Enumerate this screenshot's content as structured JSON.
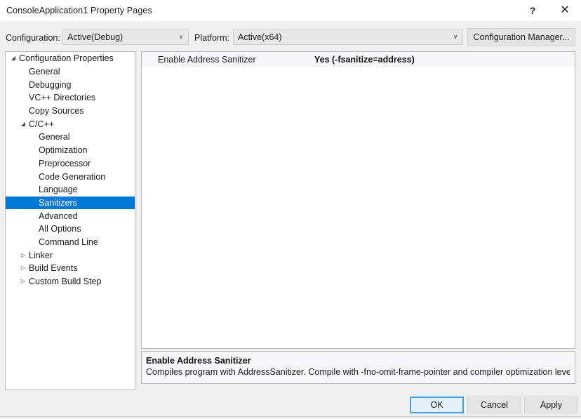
{
  "window": {
    "title": "ConsoleApplication1 Property Pages",
    "help_glyph": "?",
    "close_glyph": "✕"
  },
  "config_bar": {
    "configuration_label": "Configuration:",
    "configuration_value": "Active(Debug)",
    "platform_label": "Platform:",
    "platform_value": "Active(x64)",
    "configuration_manager_label": "Configuration Manager...",
    "dropdown_arrow": "∨"
  },
  "tree": {
    "arrow_expanded": "◢",
    "arrow_collapsed": "▷",
    "nodes": [
      {
        "label": "Configuration Properties",
        "indent": 0,
        "state": "expanded",
        "selected": false
      },
      {
        "label": "General",
        "indent": 1,
        "state": "leaf",
        "selected": false
      },
      {
        "label": "Debugging",
        "indent": 1,
        "state": "leaf",
        "selected": false
      },
      {
        "label": "VC++ Directories",
        "indent": 1,
        "state": "leaf",
        "selected": false
      },
      {
        "label": "Copy Sources",
        "indent": 1,
        "state": "leaf",
        "selected": false
      },
      {
        "label": "C/C++",
        "indent": 1,
        "state": "expanded",
        "selected": false
      },
      {
        "label": "General",
        "indent": 2,
        "state": "leaf",
        "selected": false
      },
      {
        "label": "Optimization",
        "indent": 2,
        "state": "leaf",
        "selected": false
      },
      {
        "label": "Preprocessor",
        "indent": 2,
        "state": "leaf",
        "selected": false
      },
      {
        "label": "Code Generation",
        "indent": 2,
        "state": "leaf",
        "selected": false
      },
      {
        "label": "Language",
        "indent": 2,
        "state": "leaf",
        "selected": false
      },
      {
        "label": "Sanitizers",
        "indent": 2,
        "state": "leaf",
        "selected": true
      },
      {
        "label": "Advanced",
        "indent": 2,
        "state": "leaf",
        "selected": false
      },
      {
        "label": "All Options",
        "indent": 2,
        "state": "leaf",
        "selected": false
      },
      {
        "label": "Command Line",
        "indent": 2,
        "state": "leaf",
        "selected": false
      },
      {
        "label": "Linker",
        "indent": 1,
        "state": "collapsed",
        "selected": false
      },
      {
        "label": "Build Events",
        "indent": 1,
        "state": "collapsed",
        "selected": false
      },
      {
        "label": "Custom Build Step",
        "indent": 1,
        "state": "collapsed",
        "selected": false
      }
    ]
  },
  "property_grid": {
    "rows": [
      {
        "name": "Enable Address Sanitizer",
        "value": "Yes (-fsanitize=address)"
      }
    ]
  },
  "description": {
    "title": "Enable Address Sanitizer",
    "body": "Compiles program with AddressSanitizer. Compile with -fno-omit-frame-pointer and compiler optimization level ..."
  },
  "footer": {
    "ok_label": "OK",
    "cancel_label": "Cancel",
    "apply_label": "Apply"
  },
  "colors": {
    "selection_blue": "#0078d7",
    "focus_border": "#3f9fe0",
    "window_background": "#f0f0f0",
    "panel_background": "#ffffff",
    "panel_border": "#b8b8b8"
  }
}
